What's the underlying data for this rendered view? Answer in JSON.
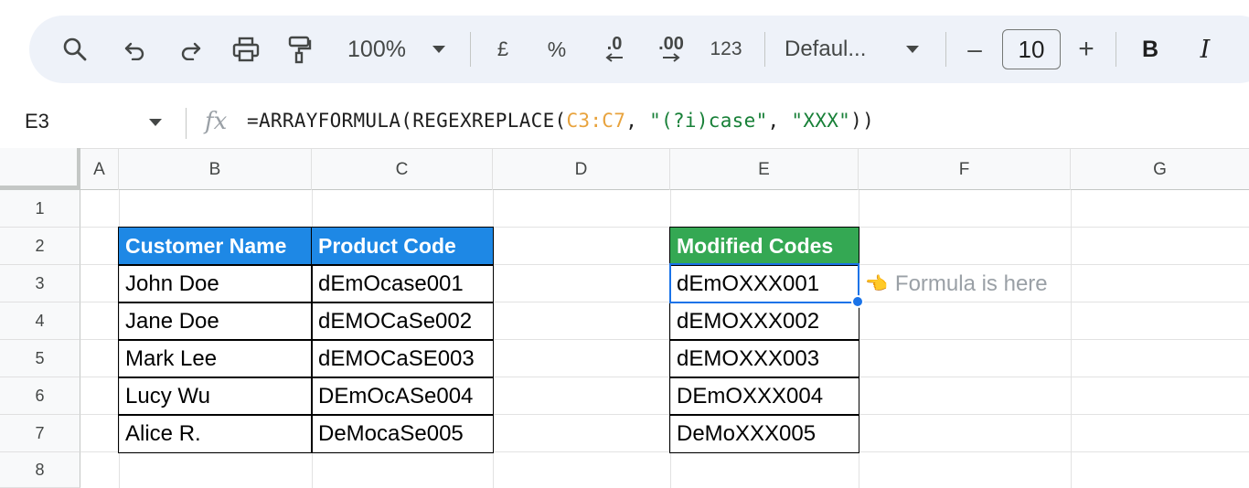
{
  "toolbar": {
    "zoom": "100%",
    "currency": "£",
    "percent": "%",
    "decrease_decimal": ".0",
    "increase_decimal": ".00",
    "number_format": "123",
    "font_name": "Defaul...",
    "font_size": "10",
    "minus": "–",
    "plus": "+",
    "bold": "B",
    "italic": "I"
  },
  "formula_bar": {
    "cell_ref": "E3",
    "fx": "fx",
    "formula_prefix": "=ARRAYFORMULA(REGEXREPLACE(",
    "formula_range": "C3:C7",
    "formula_sep1": ", ",
    "formula_pattern": "\"(?i)case\"",
    "formula_sep2": ", ",
    "formula_replacement": "\"XXX\"",
    "formula_suffix": "))"
  },
  "columns": [
    "A",
    "B",
    "C",
    "D",
    "E",
    "F",
    "G"
  ],
  "rows": [
    "1",
    "2",
    "3",
    "4",
    "5",
    "6",
    "7",
    "8"
  ],
  "table": {
    "headers": [
      "Customer Name",
      "Product Code"
    ],
    "rows": [
      [
        "John Doe",
        "dEmOcase001"
      ],
      [
        "Jane Doe",
        "dEMOCaSe002"
      ],
      [
        "Mark Lee",
        "dEMOCaSE003"
      ],
      [
        "Lucy Wu",
        "DEmOcASe004"
      ],
      [
        "Alice R.",
        "DeMocaSe005"
      ]
    ]
  },
  "result": {
    "header": "Modified Codes",
    "values": [
      "dEmOXXX001",
      "dEMOXXX002",
      "dEMOXXX003",
      "DEmOXXX004",
      "DeMoXXX005"
    ]
  },
  "note": {
    "text": "Formula is here",
    "icon": "pointing-hand-icon"
  },
  "colors": {
    "header_blue": "#1e88e5",
    "header_green": "#34a853",
    "selection": "#1a73e8"
  }
}
